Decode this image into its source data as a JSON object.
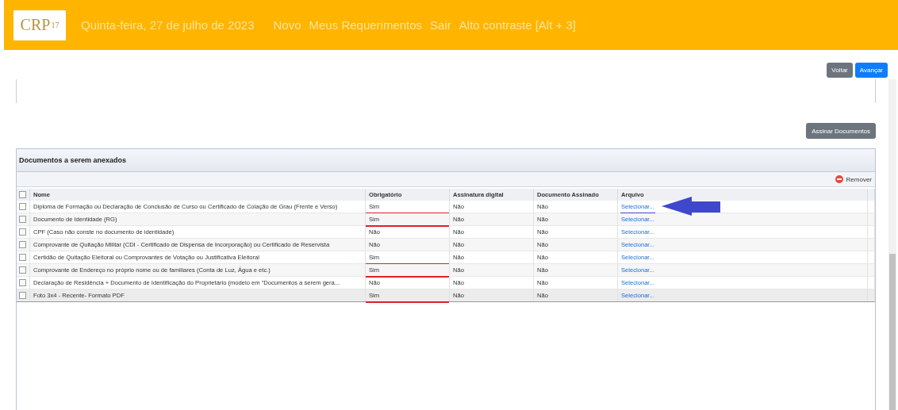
{
  "header": {
    "logo": {
      "letters": "CRP",
      "number": "17"
    },
    "date": "Quinta-feira, 27 de julho de 2023",
    "nav": [
      "Novo",
      "Meus Requerimentos",
      "Sair",
      "Alto contraste [Alt + 3]"
    ]
  },
  "top_buttons": [
    {
      "label": "Voltar",
      "kind": "secondary"
    },
    {
      "label": "Avançar",
      "kind": "primary"
    }
  ],
  "sign_button": "Assinar Documentos",
  "panel": {
    "title": "Documentos a serem anexados",
    "remove_button": "Remover",
    "columns": [
      "Nome",
      "Obrigatório",
      "Assinatura digital",
      "Documento Assinado",
      "Arquivo"
    ],
    "select_all_checked": false,
    "rows": [
      {
        "name": "Diploma de Formação ou Declaração de Conclusão de Curso ou Certificado de Colação de Grau (Frente e Verso)",
        "required": "Sim",
        "digital_signature": "Não",
        "signed": "Não",
        "file": "Selecionar...",
        "checked": false,
        "selected": false,
        "required_underlined": true,
        "arrow_pointer": true
      },
      {
        "name": "Documento de Identidade (RG)",
        "required": "Sim",
        "digital_signature": "Não",
        "signed": "Não",
        "file": "Selecionar...",
        "checked": false,
        "selected": false,
        "required_underlined": true,
        "arrow_pointer": false
      },
      {
        "name": "CPF (Caso não conste no documento de identidade)",
        "required": "Não",
        "digital_signature": "Não",
        "signed": "Não",
        "file": "Selecionar...",
        "checked": false,
        "selected": false,
        "required_underlined": false,
        "arrow_pointer": false
      },
      {
        "name": "Comprovante de Quitação Militar (CDI - Certificado de Dispensa de Incorporação) ou Certificado de Reservista",
        "required": "Não",
        "digital_signature": "Não",
        "signed": "Não",
        "file": "Selecionar...",
        "checked": false,
        "selected": false,
        "required_underlined": false,
        "arrow_pointer": false
      },
      {
        "name": "Certidão de Quitação Eleitoral ou Comprovantes de Votação ou Justificativa Eleitoral",
        "required": "Sim",
        "digital_signature": "Não",
        "signed": "Não",
        "file": "Selecionar...",
        "checked": false,
        "selected": false,
        "required_underlined": true,
        "arrow_pointer": false
      },
      {
        "name": "Comprovante de Endereço no próprio nome ou de familiares (Conta de Luz, Água e etc.)",
        "required": "Sim",
        "digital_signature": "Não",
        "signed": "Não",
        "file": "Selecionar...",
        "checked": false,
        "selected": false,
        "required_underlined": true,
        "arrow_pointer": false
      },
      {
        "name": "Declaração de Residência + Documento de Identificação do Proprietário (modelo em \"Documentos a serem gera...",
        "required": "Não",
        "digital_signature": "Não",
        "signed": "Não",
        "file": "Selecionar...",
        "checked": false,
        "selected": false,
        "required_underlined": false,
        "arrow_pointer": false
      },
      {
        "name": "Foto 3x4 - Recente- Formato PDF",
        "required": "Sim",
        "digital_signature": "Não",
        "signed": "Não",
        "file": "Selecionar...",
        "checked": false,
        "selected": true,
        "required_underlined": true,
        "arrow_pointer": false
      }
    ]
  }
}
